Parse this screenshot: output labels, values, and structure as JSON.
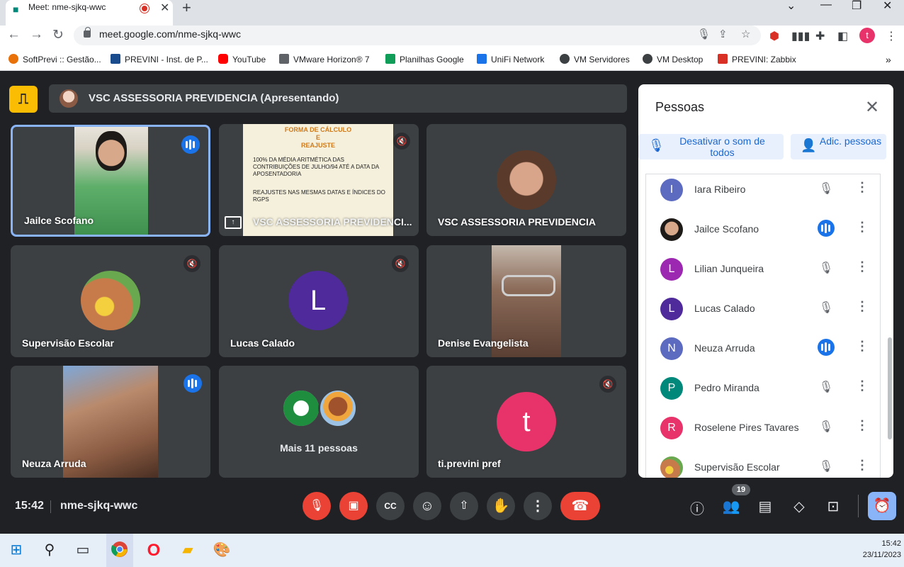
{
  "browser": {
    "tab_title": "Meet: nme-sjkq-wwc",
    "url": "meet.google.com/nme-sjkq-wwc",
    "profile_initial": "t",
    "bookmarks": [
      {
        "label": "SoftPrevi :: Gestão...",
        "color": "#e8710a"
      },
      {
        "label": "PREVINI - Inst. de P...",
        "color": "#1a4b8c"
      },
      {
        "label": "YouTube",
        "color": "#ff0000"
      },
      {
        "label": "VMware Horizon® 7",
        "color": "#5f6368"
      },
      {
        "label": "Planilhas Google",
        "color": "#0f9d58"
      },
      {
        "label": "UniFi Network",
        "color": "#1a73e8"
      },
      {
        "label": "VM Servidores",
        "color": "#3c4043"
      },
      {
        "label": "VM Desktop",
        "color": "#3c4043"
      },
      {
        "label": "PREVINI: Zabbix",
        "color": "#d93025"
      }
    ]
  },
  "meet": {
    "presenter_text": "VSC ASSESSORIA PREVIDENCIA (Apresentando)",
    "presenter_badge": "⎍",
    "tiles": [
      {
        "name": "Jailce Scofano"
      },
      {
        "name": "VSC ASSESSORIA PREVIDENCI..."
      },
      {
        "name": "VSC ASSESSORIA PREVIDENCIA"
      },
      {
        "name": "Supervisão Escolar"
      },
      {
        "name": "Lucas Calado",
        "initial": "L",
        "color": "#4e2a9a"
      },
      {
        "name": "Denise Evangelista"
      },
      {
        "name": "Neuza Arruda"
      },
      {
        "name": "Mais 11 pessoas"
      },
      {
        "name": "ti.previni pref",
        "initial": "t",
        "color": "#e8336a"
      }
    ],
    "slide": {
      "title_line1": "FORMA DE CÁLCULO",
      "title_line2": "E",
      "title_line3": "REAJUSTE",
      "bullet1": "100% DA MÉDIA ARITMÉTICA DAS CONTRIBUIÇÕES DE JULHO/94 ATÉ A DATA DA APOSENTADORIA",
      "bullet2": "REAJUSTES NAS MESMAS DATAS E ÍNDICES DO RGPS"
    },
    "time": "15:42",
    "meeting_code": "nme-sjkq-wwc",
    "people_count": "19"
  },
  "panel": {
    "title": "Pessoas",
    "mute_all_label": "Desativar o som de todos",
    "add_people_label": "Adic. pessoas",
    "people": [
      {
        "name": "Iara Ribeiro",
        "initial": "I",
        "color": "#5c6bc0",
        "speaking": false
      },
      {
        "name": "Jailce Scofano",
        "initial": "",
        "color": "#3c4043",
        "speaking": true
      },
      {
        "name": "Lilian Junqueira",
        "initial": "L",
        "color": "#9c27b0",
        "speaking": false
      },
      {
        "name": "Lucas Calado",
        "initial": "L",
        "color": "#4e2a9a",
        "speaking": false
      },
      {
        "name": "Neuza Arruda",
        "initial": "N",
        "color": "#5c6bc0",
        "speaking": true
      },
      {
        "name": "Pedro Miranda",
        "initial": "P",
        "color": "#00897b",
        "speaking": false
      },
      {
        "name": "Roselene Pires Tavares",
        "initial": "R",
        "color": "#e8336a",
        "speaking": false
      },
      {
        "name": "Supervisão Escolar",
        "initial": "",
        "color": "#6b8e23",
        "speaking": false
      }
    ]
  },
  "taskbar": {
    "time": "15:42",
    "date": "23/11/2023"
  }
}
